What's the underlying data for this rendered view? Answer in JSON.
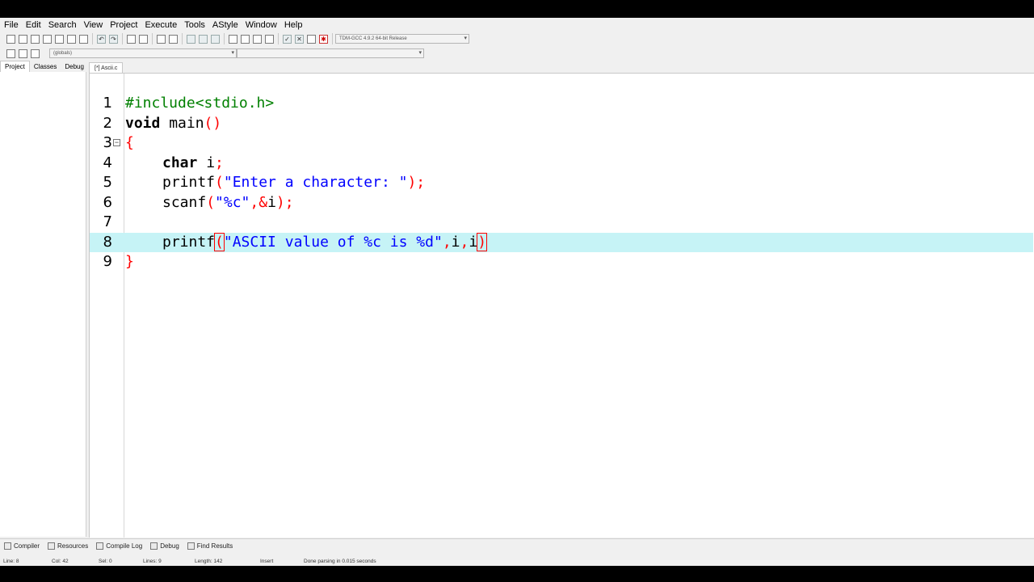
{
  "menu": [
    "File",
    "Edit",
    "Search",
    "View",
    "Project",
    "Execute",
    "Tools",
    "AStyle",
    "Window",
    "Help"
  ],
  "toolbar": {
    "compiler_select": "TDM-GCC 4.9.2 64-bit Release",
    "class_scope": "(globals)",
    "function_scope": ""
  },
  "left_tabs": [
    "Project",
    "Classes",
    "Debug"
  ],
  "editor_tab": "[*] Ascii.c",
  "code_lines": [
    {
      "n": "1",
      "text": "#include<stdio.h>"
    },
    {
      "n": "2",
      "text": "void main()"
    },
    {
      "n": "3",
      "text": "{"
    },
    {
      "n": "4",
      "text": "char i;"
    },
    {
      "n": "5",
      "text": "printf(\"Enter a character: \");"
    },
    {
      "n": "6",
      "text": "scanf(\"%c\",&i);"
    },
    {
      "n": "7",
      "text": ""
    },
    {
      "n": "8",
      "text": "printf(\"ASCII value of %c is %d\",i,i)"
    },
    {
      "n": "9",
      "text": "}"
    }
  ],
  "current_line": 8,
  "bottom_tabs": [
    "Compiler",
    "Resources",
    "Compile Log",
    "Debug",
    "Find Results"
  ],
  "status": {
    "line": "Line:   8",
    "col": "Col:   42",
    "sel": "Sel:   0",
    "lines": "Lines:   9",
    "length": "Length:   142",
    "mode": "Insert",
    "message": "Done parsing in 0.015 seconds"
  }
}
